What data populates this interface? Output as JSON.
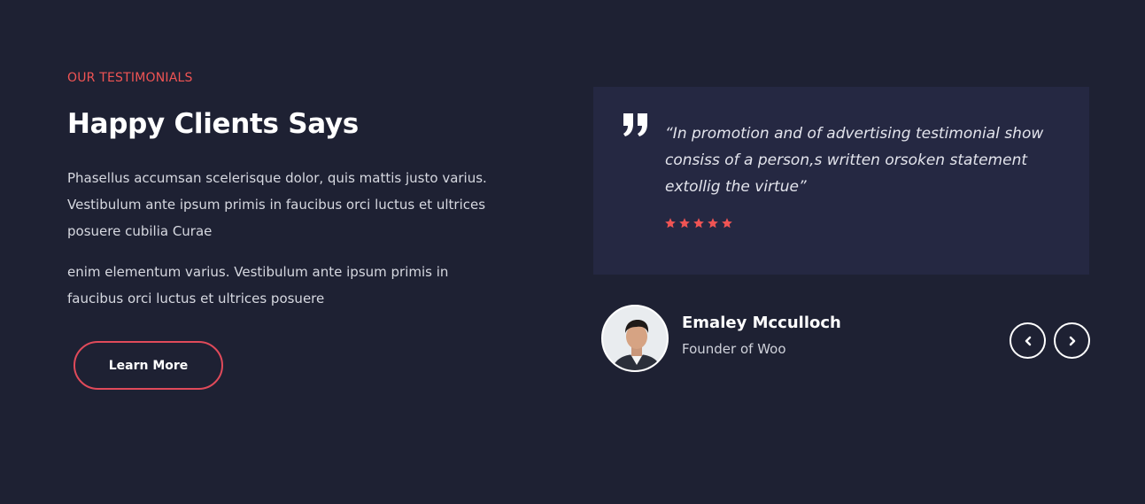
{
  "testimonials": {
    "eyebrow": "OUR TESTIMONIALS",
    "title": "Happy Clients Says",
    "paragraph_1": "Phasellus accumsan scelerisque dolor, quis mattis justo varius. Vestibulum ante ipsum primis in faucibus orci luctus et ultrices posuere cubilia Curae",
    "paragraph_2": "enim elementum varius. Vestibulum ante ipsum primis in faucibus orci luctus et ultrices posuere",
    "button_label": "Learn More"
  },
  "review": {
    "quote_icon": "quote-icon",
    "quote": "“In promotion and of advertising testimonial show consiss of a person,s written orsoken statement extollig the virtue”",
    "rating": 5,
    "rating_max": 5,
    "author_name": "Emaley Mcculloch",
    "author_role": "Founder of Woo"
  },
  "nav": {
    "prev_icon": "chevron-left-icon",
    "next_icon": "chevron-right-icon"
  },
  "colors": {
    "background": "#1e2133",
    "card": "#252842",
    "accent": "#f05454",
    "button_border": "#e04a5a"
  }
}
